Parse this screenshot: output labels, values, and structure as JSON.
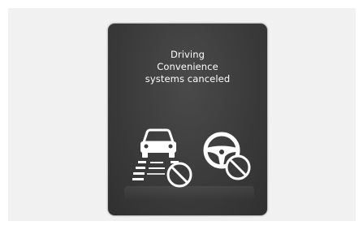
{
  "notification": {
    "lines": [
      "Driving",
      "Convenience",
      "systems canceled"
    ]
  },
  "icons": {
    "lane_assist": "car-lane-cancel-icon",
    "steering": "steering-wheel-cancel-icon"
  },
  "colors": {
    "panel_background": "#3b3b3b",
    "text": "#ffffff",
    "icon": "#ffffff"
  }
}
